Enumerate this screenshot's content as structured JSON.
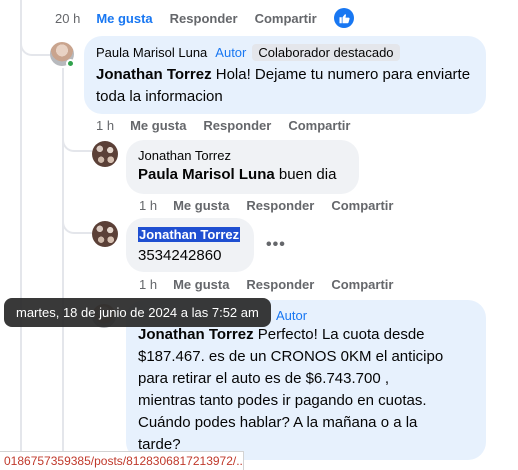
{
  "top_actions": {
    "time": "20 h",
    "like": "Me gusta",
    "reply": "Responder",
    "share": "Compartir"
  },
  "comment_paula": {
    "author": "Paula Marisol Luna",
    "author_tag": "Autor",
    "badge": "Colaborador destacado",
    "mention": "Jonathan Torrez",
    "text": " Hola! Dejame tu numero para enviarte toda la informacion",
    "time": "1 h",
    "like": "Me gusta",
    "reply": "Responder",
    "share": "Compartir"
  },
  "comment_jt1": {
    "author": "Jonathan Torrez",
    "mention": "Paula Marisol Luna",
    "text": " buen dia",
    "time": "1 h",
    "like": "Me gusta",
    "reply": "Responder",
    "share": "Compartir"
  },
  "comment_jt2": {
    "author": "Jonathan Torrez",
    "text": "3534242860",
    "more": "•••",
    "time": "1 h",
    "like": "Me gusta",
    "reply": "Responder",
    "share": "Compartir"
  },
  "comment_paula2": {
    "author_tag": "Autor",
    "mention": "Jonathan Torrez",
    "lines": [
      " Perfecto! La cuota desde",
      "$187.467. es de un CRONOS 0KM el anticipo",
      "para retirar el auto es de $6.743.700 ,",
      "mientras tanto podes ir pagando en cuotas.",
      "Cuándo podes hablar? A la mañana o a la",
      "tarde?"
    ]
  },
  "tooltip": "martes, 18 de junio de 2024 a las 7:52 am",
  "status_url": "0186757359385/posts/8128306817213972/...",
  "colors": {
    "accent": "#1877f2",
    "bubble": "#f0f2f5",
    "highlight": "#e7f1fd"
  }
}
